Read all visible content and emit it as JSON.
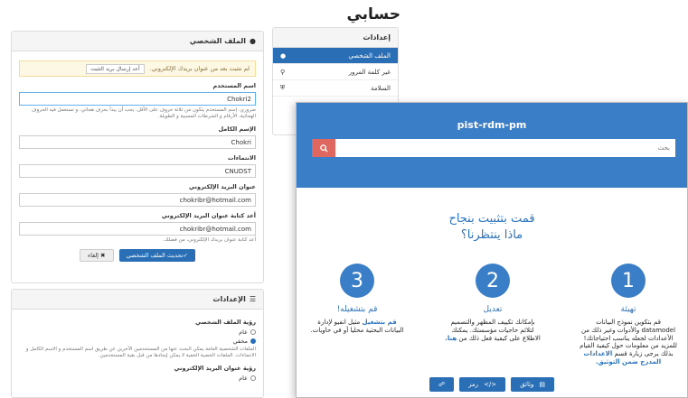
{
  "account": {
    "title": "حسابي",
    "settings_nav": {
      "header": "إعدادات",
      "items": [
        {
          "label": "الملف الشخصي",
          "icon": "user-icon",
          "active": true
        },
        {
          "label": "غير كلمة المرور",
          "icon": "key-icon",
          "active": false
        },
        {
          "label": "السلامة",
          "icon": "shield-icon",
          "active": false
        }
      ]
    },
    "profile": {
      "header": "الملف الشخصي",
      "alert_text": "لم نتثبت بعد من عنوان بريدك الإلكتروني.",
      "alert_button": "أعد إرسال بريد التثبت",
      "username_label": "اسم المستخدم",
      "username_value": "Chokri2",
      "username_help": "ضروري. إسم المستخدم يتكون من ثلاثة حروف على الأقل. يجب أن يبدأ بحرف هجائي. و تستعمل فيه الحروف الهجائية، الأرقام و الشرطات المسبية و الطويلة.",
      "fullname_label": "الإسم الكامل",
      "fullname_value": "Chokri",
      "affiliation_label": "الانتماءات",
      "affiliation_value": "CNUDST",
      "email_label": "عنوان البريد الإلكتروني",
      "email_value": "chokribr@hotmail.com",
      "email_confirm_label": "أعد كتابة عنوان البريد الإلكتروني",
      "email_confirm_value": "chokribr@hotmail.com",
      "email_confirm_help": "أعد كتابة عنوان بريدك الإلكتروني، من فضلك.",
      "save_button": "✓تحديث الملف الشخصي",
      "cancel_button": "✖ إلغاء"
    },
    "prefs": {
      "header": "الإعدادات",
      "profile_vis_label": "رؤية الملف الشخصي",
      "opt_public": "عام",
      "opt_hidden": "مخفي",
      "vis_help": "الملفات الشخصية العامة يمكن البحث عنها من المستخدمين الآخرين عن طريق اسم المستخدم و الاسم الكامل و الانتماءات. الملفات الخصية الخفية لا يمكن إيجادها من قبل بقية المستخدمين.",
      "email_vis_label": "رؤية عنوان البريد الإلكتروني",
      "opt_public2": "عام"
    }
  },
  "modal": {
    "title": "pist-rdm-pm",
    "search_placeholder": "بحث",
    "welcome_line1": "قمت بتثبيت بنجاح",
    "welcome_line2": "ماذا ينتظرنا؟",
    "steps": [
      {
        "number": "1",
        "title": "تهيئة",
        "text": "قم بتكوين نموذج البيانات datamodel والأدوات وغير ذلك من الأعدادات لجعله يناسب احتياجاتك! للمزيد من معلومات حول كيفية القيام بذلك يرجى زيارة قسم ",
        "link": "الاعدادات المدرج ضمن التوثيق."
      },
      {
        "number": "2",
        "title": "تعديل",
        "text": "بإمكانك تكييف المظهر والتصميم لتلائم حاجيات مؤسستك. يمكنك الاطلاع على كيفية فعل ذلك من ",
        "link": "هنا."
      },
      {
        "number": "3",
        "title": "قم بتشغيله!",
        "text": " مثيل انفيو لإدارة البيانات البحثية محليا أو في حاويات.",
        "link": "قم بتشغيل"
      }
    ],
    "footer": {
      "docs_label": "وثائق",
      "code_label": "رمز"
    }
  },
  "colors": {
    "primary": "#2a6fb5",
    "header_blue": "#3b7ec8",
    "search_red": "#e0675f",
    "warning_bg": "#fcf8e3"
  }
}
